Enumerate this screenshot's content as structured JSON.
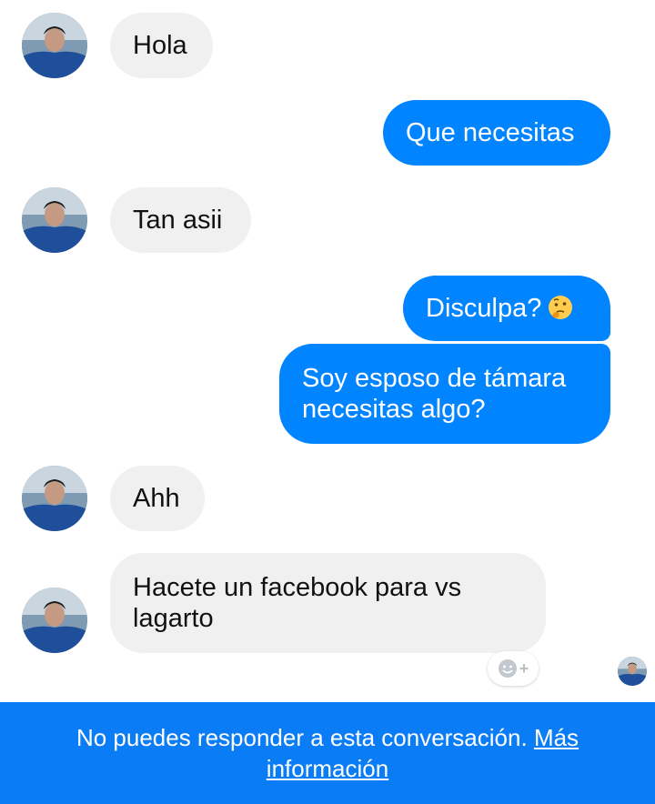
{
  "messages": [
    {
      "from": "them",
      "text": "Hola"
    },
    {
      "from": "me",
      "text": "Que necesitas"
    },
    {
      "from": "them",
      "text": "Tan asii"
    },
    {
      "from": "me",
      "text": "Disculpa?",
      "emoji": "thinking-face"
    },
    {
      "from": "me",
      "text_lines": [
        "Soy esposo de támara",
        "necesitas algo?"
      ]
    },
    {
      "from": "them",
      "text": "Ahh"
    },
    {
      "from": "them",
      "text_lines": [
        "Hacete un facebook para vs",
        "lagarto"
      ]
    }
  ],
  "reaction_button": {
    "icon": "smiley-icon",
    "plus": "+"
  },
  "footer": {
    "notice": "No puedes responder a esta conversación.",
    "link_part1": "Más",
    "link_part2": "información"
  },
  "colors": {
    "outgoing_bubble": "#0084ff",
    "incoming_bubble": "#f1f0f0",
    "footer_bar": "#0a7cf6"
  }
}
